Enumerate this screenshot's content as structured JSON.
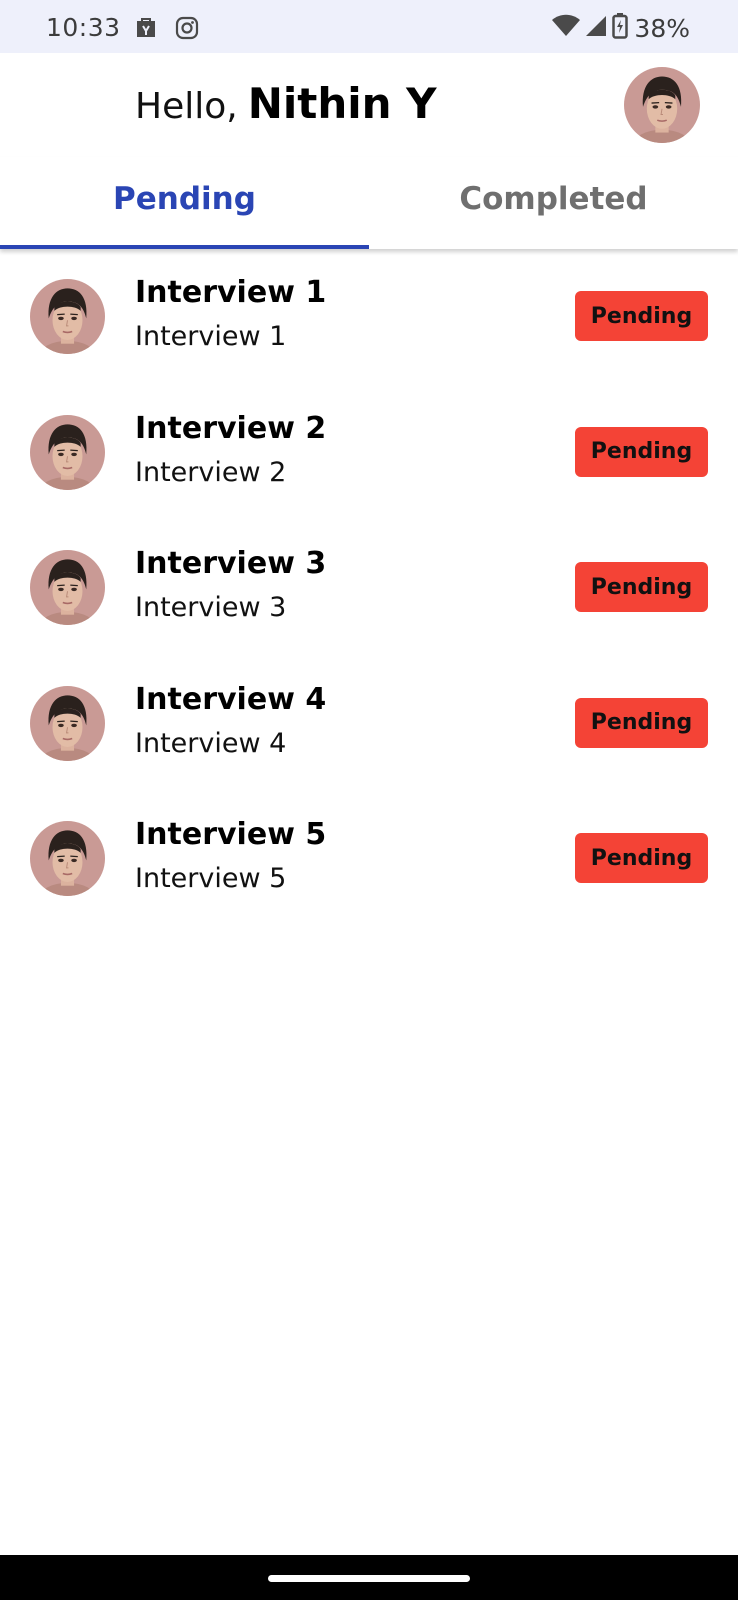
{
  "status_bar": {
    "time": "10:33",
    "battery": "38%",
    "icons": [
      "shopping-bag-icon",
      "instagram-icon",
      "wifi-icon",
      "signal-icon",
      "battery-icon"
    ]
  },
  "header": {
    "greeting": "Hello,",
    "user_name": "Nithin Y",
    "avatar": "profile-avatar"
  },
  "tabs": [
    {
      "label": "Pending",
      "active": true
    },
    {
      "label": "Completed",
      "active": false
    }
  ],
  "interviews": [
    {
      "title": "Interview 1",
      "subtitle": "Interview 1",
      "status": "Pending"
    },
    {
      "title": "Interview 2",
      "subtitle": "Interview 2",
      "status": "Pending"
    },
    {
      "title": "Interview 3",
      "subtitle": "Interview 3",
      "status": "Pending"
    },
    {
      "title": "Interview 4",
      "subtitle": "Interview 4",
      "status": "Pending"
    },
    {
      "title": "Interview 5",
      "subtitle": "Interview 5",
      "status": "Pending"
    }
  ],
  "colors": {
    "accent": "#2a45b4",
    "badge": "#f44336",
    "status_bar_bg": "#eef0fb",
    "inactive_tab": "#6f6f6f"
  }
}
